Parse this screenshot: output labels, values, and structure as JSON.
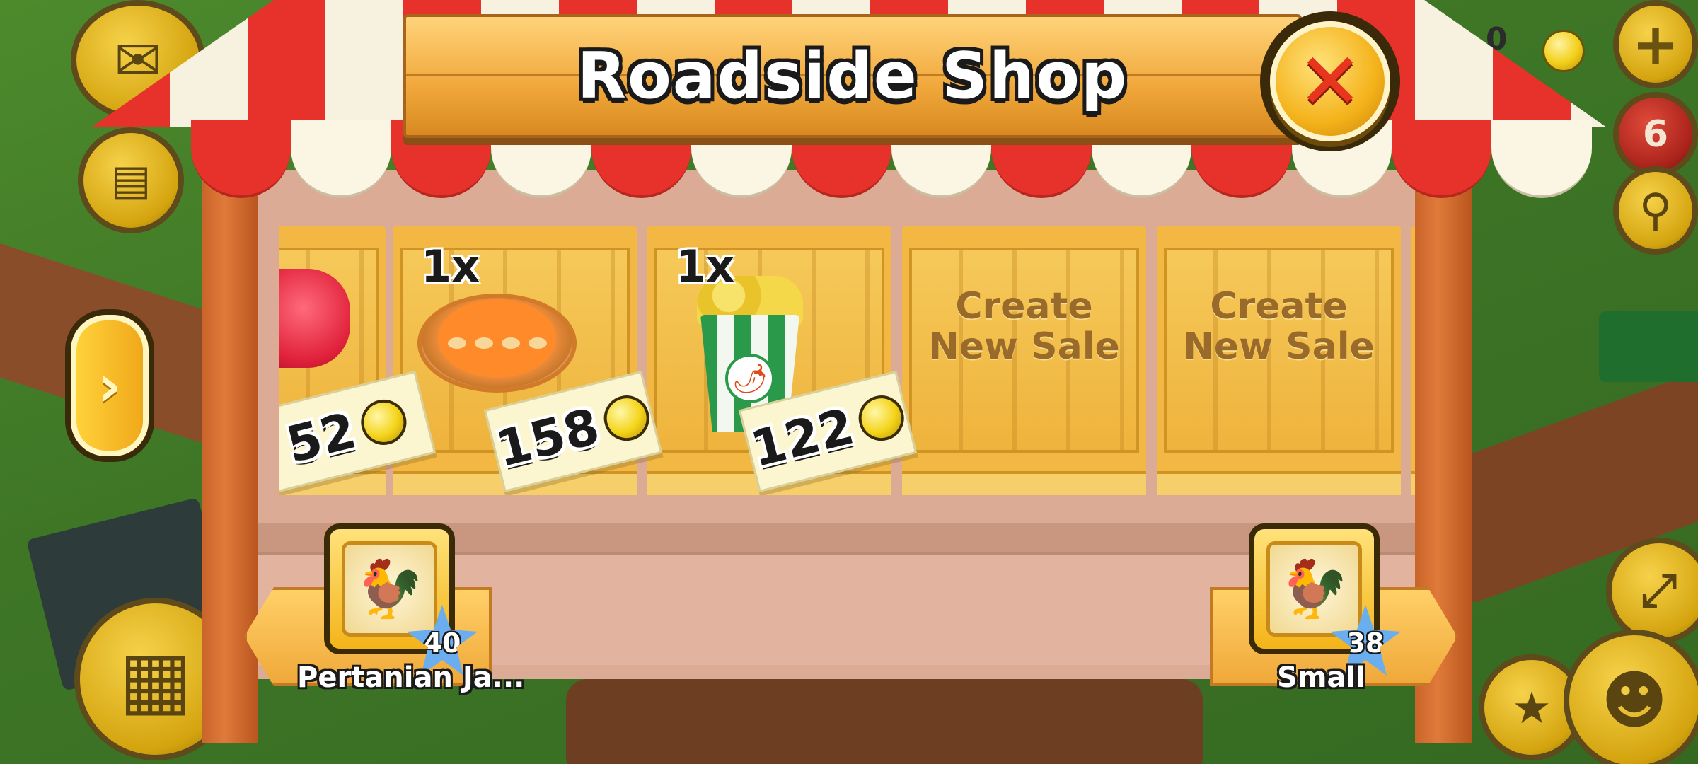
{
  "window": {
    "title": "Roadside Shop",
    "close_icon": "close-x-icon"
  },
  "hud": {
    "coins_display": "0",
    "gem_count": "6"
  },
  "crates": [
    {
      "quantity": "",
      "item_icon": "red-heart-item-icon",
      "price": "52"
    },
    {
      "quantity": "1x",
      "item_icon": "pumpkin-pie-icon",
      "price": "158"
    },
    {
      "quantity": "1x",
      "item_icon": "chili-popcorn-icon",
      "price": "122"
    },
    {
      "create_label_line1": "Create",
      "create_label_line2": "New Sale"
    },
    {
      "create_label_line1": "Create",
      "create_label_line2": "New Sale"
    }
  ],
  "neighbors": [
    {
      "name": "Pertanian Ja...",
      "level": "40",
      "avatar_icon": "rooster-icon"
    },
    {
      "name": "Small",
      "level": "38",
      "avatar_icon": "rooster-icon"
    }
  ],
  "colors": {
    "awning_red": "#e6322a",
    "awning_white": "#fbf5e3",
    "plank": "#f0a73a",
    "coin": "#f4d41a",
    "star": "#6aaef0"
  }
}
